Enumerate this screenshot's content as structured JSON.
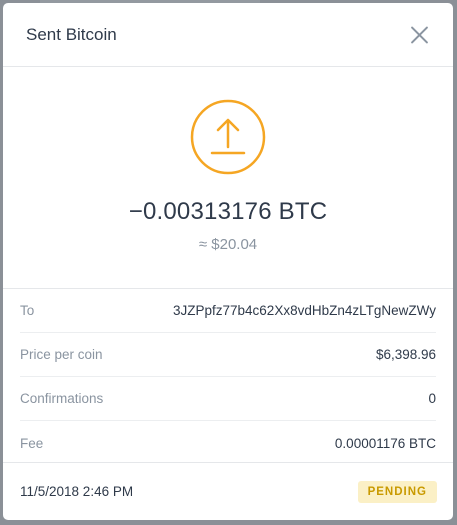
{
  "modal": {
    "title": "Sent Bitcoin",
    "close_icon": "close-icon"
  },
  "transaction": {
    "icon": "send-arrow-icon",
    "icon_color": "#F5A623",
    "amount": "−0.00313176 BTC",
    "fiat_value": "≈ $20.04"
  },
  "details": [
    {
      "label": "To",
      "value": "3JZPpfz77b4c62Xx8vdHbZn4zLTgNewZWy"
    },
    {
      "label": "Price per coin",
      "value": "$6,398.96"
    },
    {
      "label": "Confirmations",
      "value": "0"
    },
    {
      "label": "Fee",
      "value": "0.00001176 BTC"
    }
  ],
  "footer": {
    "timestamp": "11/5/2018 2:46 PM",
    "status": "PENDING",
    "status_bg": "#FBF0C6",
    "status_color": "#C99A00"
  }
}
